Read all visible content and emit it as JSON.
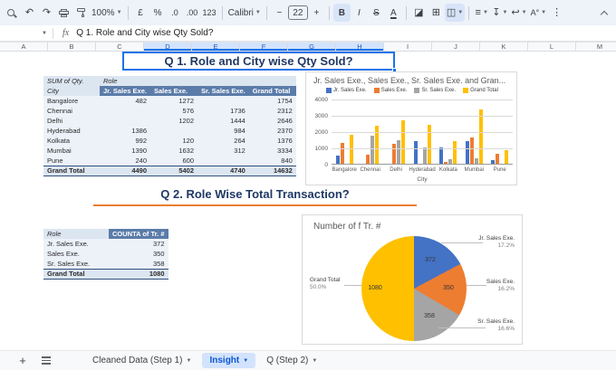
{
  "toolbar": {
    "zoom_value": "100%",
    "currency_label": "£",
    "percent_label": "%",
    "decrease_decimal_label": ".0",
    "increase_decimal_label": ".00",
    "more_formats_label": "123",
    "font_name": "Calibri",
    "decrease_font_label": "−",
    "font_size": "22",
    "increase_font_label": "+",
    "bold_label": "B",
    "italic_label": "I",
    "strikethrough_label": "S",
    "text_color_label": "A",
    "fill_color_label": "◪",
    "borders_label": "⊞",
    "merge_label": "◫",
    "h_align_label": "≡",
    "v_align_label": "↧",
    "wrap_label": "↩",
    "rotate_label": "A°",
    "more_label": "⋮"
  },
  "formula_bar": {
    "fx_label": "fx",
    "value": "Q 1. Role and City wise Qty Sold?"
  },
  "column_headers": {
    "letters": [
      "A",
      "B",
      "C",
      "D",
      "E",
      "F",
      "G",
      "H",
      "I",
      "J",
      "K",
      "L",
      "M"
    ],
    "selected": [
      "D",
      "E",
      "F",
      "G",
      "H"
    ]
  },
  "q1": {
    "title": "Q 1. Role and City wise Qty Sold?",
    "pivot": {
      "corner_label": "SUM of Qty.",
      "col_dim_label": "Role",
      "row_dim_label": "City",
      "columns": [
        "Jr. Sales Exe.",
        "Sales Exe.",
        "Sr. Sales Exe.",
        "Grand Total"
      ],
      "rows": [
        {
          "city": "Bangalore",
          "values": [
            "482",
            "1272",
            "",
            "1754"
          ]
        },
        {
          "city": "Chennai",
          "values": [
            "",
            "576",
            "1736",
            "2312"
          ]
        },
        {
          "city": "Delhi",
          "values": [
            "",
            "1202",
            "1444",
            "2646"
          ]
        },
        {
          "city": "Hyderabad",
          "values": [
            "1386",
            "",
            "984",
            "2370"
          ]
        },
        {
          "city": "Kolkata",
          "values": [
            "992",
            "120",
            "264",
            "1376"
          ]
        },
        {
          "city": "Mumbai",
          "values": [
            "1390",
            "1632",
            "312",
            "3334"
          ]
        },
        {
          "city": "Pune",
          "values": [
            "240",
            "600",
            "",
            "840"
          ]
        }
      ],
      "grand_total": {
        "label": "Grand Total",
        "values": [
          "4490",
          "5402",
          "4740",
          "14632"
        ]
      }
    }
  },
  "q2": {
    "title": "Q 2. Role Wise Total Transaction?",
    "table": {
      "columns": [
        "Role",
        "COUNTA of Tr. #"
      ],
      "rows": [
        {
          "role": "Jr. Sales Exe.",
          "count": "372"
        },
        {
          "role": "Sales Exe.",
          "count": "350"
        },
        {
          "role": "Sr. Sales Exe.",
          "count": "358"
        }
      ],
      "grand_total": {
        "label": "Grand Total",
        "count": "1080"
      }
    }
  },
  "chart_data": [
    {
      "type": "bar",
      "title": "Jr. Sales Exe., Sales Exe., Sr. Sales Exe. and Gran...",
      "categories": [
        "Bangalore",
        "Chennai",
        "Delhi",
        "Hyderabad",
        "Kolkata",
        "Mumbai",
        "Pune"
      ],
      "series": [
        {
          "name": "Jr. Sales Exe.",
          "color": "#4472C4",
          "values": [
            482,
            0,
            0,
            1386,
            992,
            1390,
            240
          ]
        },
        {
          "name": "Sales Exe.",
          "color": "#ED7D31",
          "values": [
            1272,
            576,
            1202,
            0,
            120,
            1632,
            600
          ]
        },
        {
          "name": "Sr. Sales Exe.",
          "color": "#A5A5A5",
          "values": [
            0,
            1736,
            1444,
            984,
            264,
            312,
            0
          ]
        },
        {
          "name": "Grand Total",
          "color": "#FFC000",
          "values": [
            1754,
            2312,
            2646,
            2370,
            1376,
            3334,
            840
          ]
        }
      ],
      "xlabel": "City",
      "ylim": [
        0,
        4000
      ],
      "yticks": [
        0,
        1000,
        2000,
        3000,
        4000
      ],
      "legend_position": "top",
      "grid": true
    },
    {
      "type": "pie",
      "title": "Number of f Tr. #",
      "slices": [
        {
          "name": "Jr. Sales Exe.",
          "value": 372,
          "pct": "17.2%",
          "color": "#4472C4"
        },
        {
          "name": "Sales Exe.",
          "value": 350,
          "pct": "16.2%",
          "color": "#ED7D31"
        },
        {
          "name": "Sr. Sales Exe.",
          "value": 358,
          "pct": "16.6%",
          "color": "#A5A5A5"
        },
        {
          "name": "Grand Total",
          "value": 1080,
          "pct": "50.0%",
          "color": "#FFC000"
        }
      ],
      "legend_position": "none"
    }
  ],
  "sheet_tabs": {
    "tabs": [
      {
        "label": "Cleaned Data (Step 1)",
        "active": false
      },
      {
        "label": "Insight",
        "active": true
      },
      {
        "label": "Q (Step 2)",
        "active": false
      }
    ]
  },
  "colors": {
    "selection_blue": "#1a73e8",
    "title_navy": "#1F3864",
    "underline_orange": "#ED7D31",
    "pivot_header_blue": "#5B7CA9",
    "active_tab_blue": "#0B57D0",
    "toolbar_bg": "#EEF2F9"
  }
}
